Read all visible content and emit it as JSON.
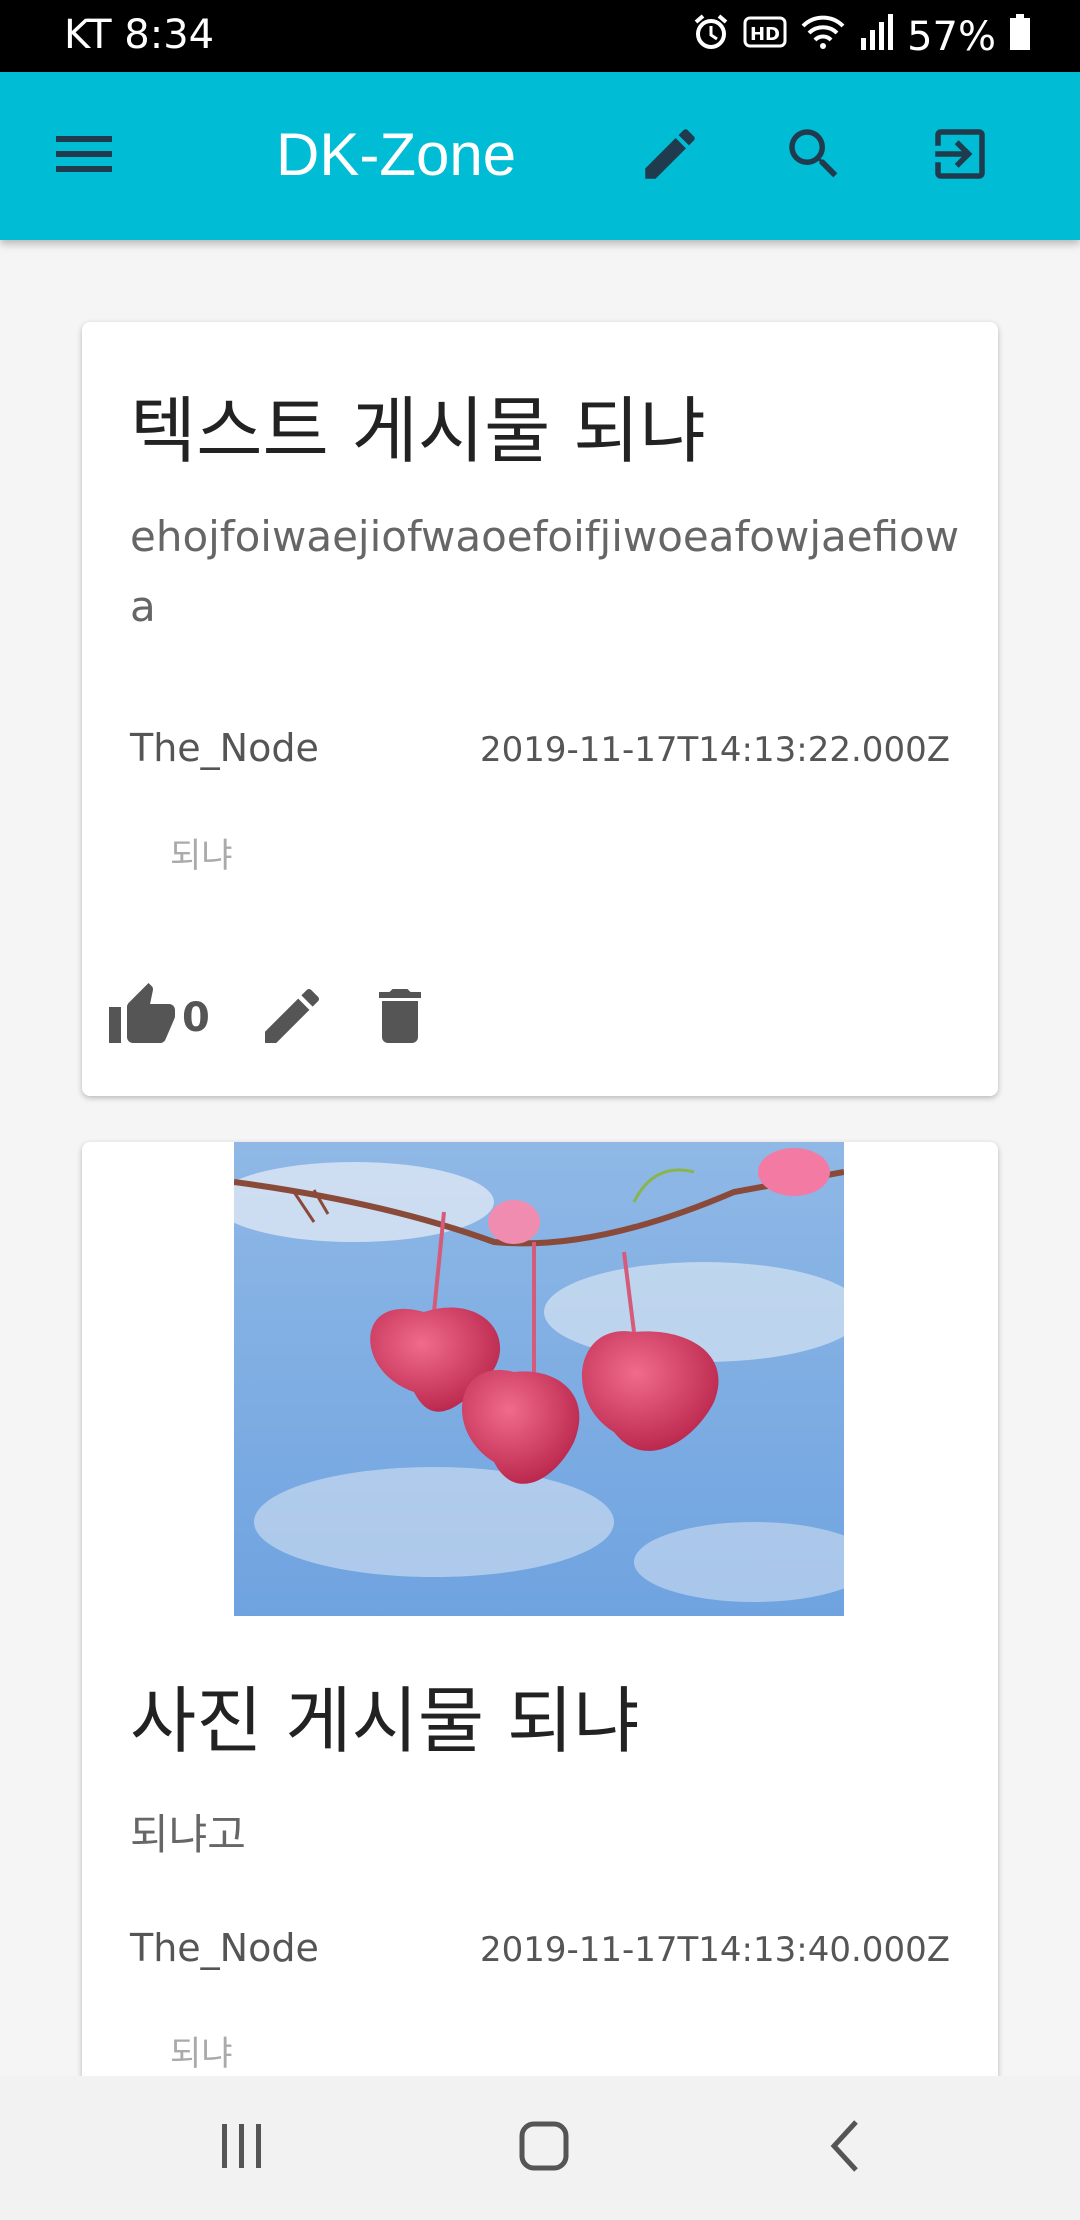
{
  "status_bar": {
    "carrier_time": "KT 8:34",
    "battery": "57%",
    "icons": [
      "alarm-icon",
      "hd-icon",
      "wifi-icon",
      "signal-icon",
      "battery-icon"
    ]
  },
  "app_bar": {
    "title": "DK-Zone",
    "color": "#00bcd4",
    "icons": [
      "menu-icon",
      "pencil-icon",
      "search-icon",
      "logout-icon"
    ]
  },
  "posts": [
    {
      "title": "텍스트 게시물 되냐",
      "body": "ehojfoiwaejiofwaoefoifjiwoeafowjaefiowa",
      "author": "The_Node",
      "date": "2019-11-17T14:13:22.000Z",
      "tag": "되냐",
      "likes": "0",
      "actions": [
        "thumb-up-icon",
        "pencil-icon",
        "trash-icon"
      ]
    },
    {
      "title": "사진 게시물 되냐",
      "body": "되냐고",
      "author": "The_Node",
      "date": "2019-11-17T14:13:40.000Z",
      "tag": "되냐",
      "image": "photo of pink heart-shaped flowers hanging from a branch against blue sky"
    }
  ],
  "nav_bar": {
    "icons": [
      "recent-apps-icon",
      "home-icon",
      "back-icon"
    ]
  }
}
